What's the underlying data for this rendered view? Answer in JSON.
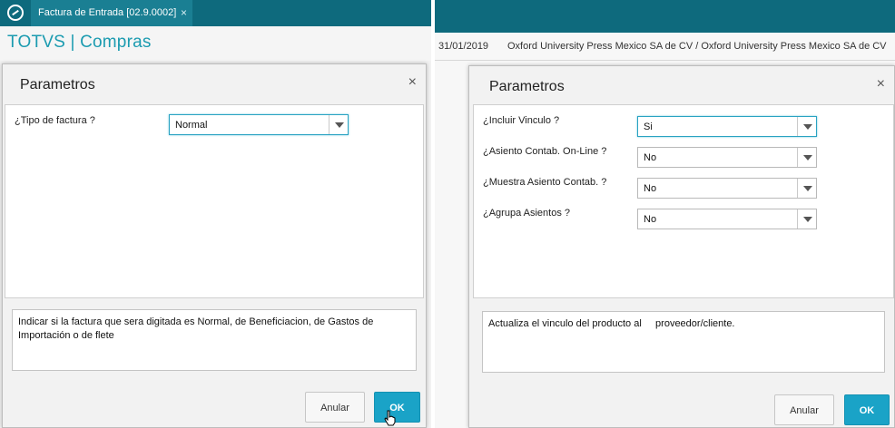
{
  "left": {
    "tab": {
      "title": "Factura de Entrada [02.9.0002]",
      "close": "×"
    },
    "app_title": "TOTVS | Compras",
    "dialog": {
      "title": "Parametros",
      "close": "×",
      "fields": [
        {
          "label": "¿Tipo de factura ?",
          "value": "Normal"
        }
      ],
      "help_text": "Indicar si la factura que sera digitada es Normal, de Beneficiacion, de Gastos de Importación o de flete",
      "cancel_label": "Anular",
      "ok_label": "OK"
    }
  },
  "right": {
    "infobar": {
      "date": "31/01/2019",
      "company": "Oxford University Press Mexico SA de CV / Oxford University Press Mexico SA de CV"
    },
    "dialog": {
      "title": "Parametros",
      "close": "×",
      "fields": [
        {
          "label": "¿Incluir Vinculo ?",
          "value": "Si"
        },
        {
          "label": "¿Asiento Contab. On-Line ?",
          "value": "No"
        },
        {
          "label": "¿Muestra Asiento Contab. ?",
          "value": "No"
        },
        {
          "label": "¿Agrupa Asientos ?",
          "value": "No"
        }
      ],
      "help_text": "Actualiza el vinculo del producto al     proveedor/cliente.",
      "cancel_label": "Anular",
      "ok_label": "OK"
    }
  },
  "colors": {
    "topbar": "#0e6a7d",
    "accent": "#1aa3c7",
    "title_text": "#1b9bb0"
  },
  "icons": [
    "logo-icon",
    "close-icon",
    "chevron-down-icon",
    "hand-cursor-icon"
  ]
}
